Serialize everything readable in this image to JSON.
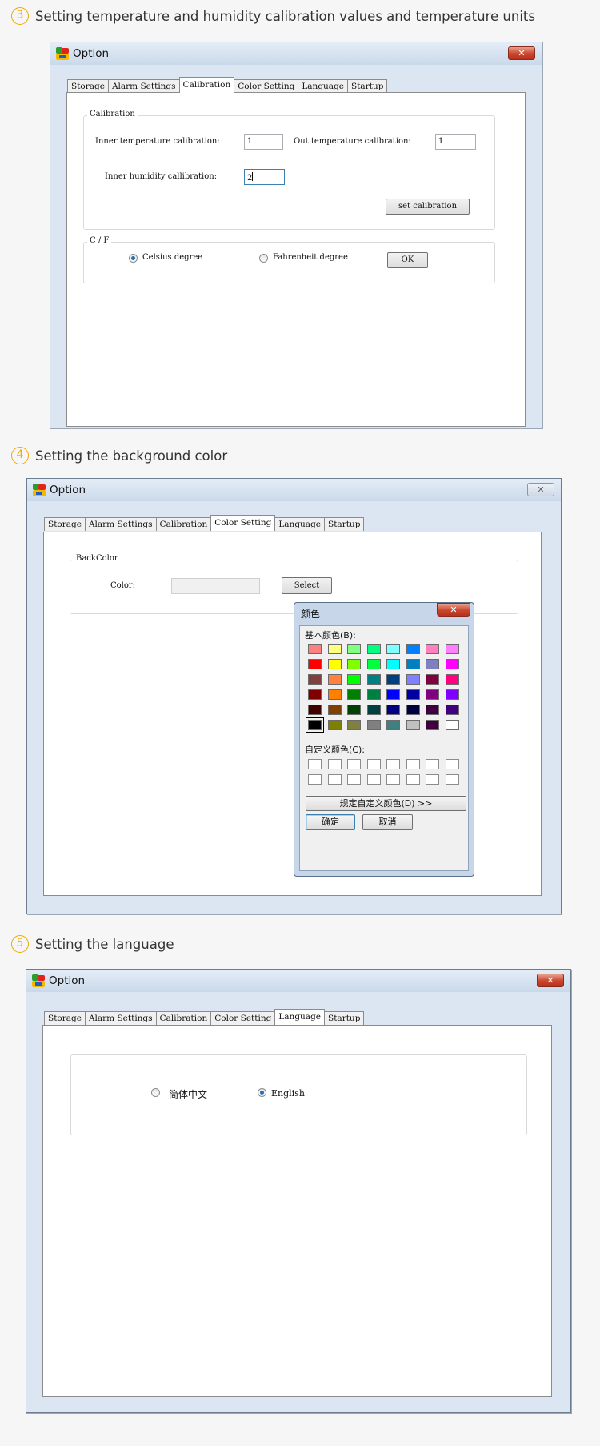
{
  "steps": [
    {
      "num": "3",
      "text": "Setting temperature and humidity calibration values and temperature units"
    },
    {
      "num": "4",
      "text": "Setting the background color"
    },
    {
      "num": "5",
      "text": "Setting the language"
    }
  ],
  "window": {
    "title": "Option",
    "close_glyph": "✕",
    "tabs": [
      "Storage",
      "Alarm Settings",
      "Calibration",
      "Color Setting",
      "Language",
      "Startup"
    ]
  },
  "calibration": {
    "group_label": "Calibration",
    "inner_temp_label": "Inner temperature calibration:",
    "inner_temp_value": "1",
    "out_temp_label": "Out temperature calibration:",
    "out_temp_value": "1",
    "inner_humidity_label": "Inner humidity callibration:",
    "inner_humidity_value": "2",
    "set_button": "set calibration",
    "unit_group_label": "C / F",
    "celsius_label": "Celsius degree",
    "fahrenheit_label": "Fahrenheit degree",
    "selected_unit": "celsius",
    "ok_button": "OK"
  },
  "color_setting": {
    "group_label": "BackColor",
    "color_label": "Color:",
    "select_button": "Select",
    "dialog": {
      "title": "颜色",
      "basic_colors_label": "基本颜色(B):",
      "custom_colors_label": "自定义颜色(C):",
      "define_button": "规定自定义颜色(D) >>",
      "ok_button": "确定",
      "cancel_button": "取消",
      "basic_colors": [
        [
          "#ff8080",
          "#ffff80",
          "#80ff80",
          "#00ff80",
          "#80ffff",
          "#0080ff",
          "#ff80c0",
          "#ff80ff"
        ],
        [
          "#ff0000",
          "#ffff00",
          "#80ff00",
          "#00ff40",
          "#00ffff",
          "#0080c0",
          "#8080c0",
          "#ff00ff"
        ],
        [
          "#804040",
          "#ff8040",
          "#00ff00",
          "#008080",
          "#004080",
          "#8080ff",
          "#800040",
          "#ff0080"
        ],
        [
          "#800000",
          "#ff8000",
          "#008000",
          "#008040",
          "#0000ff",
          "#0000a0",
          "#800080",
          "#8000ff"
        ],
        [
          "#400000",
          "#804000",
          "#004000",
          "#004040",
          "#000080",
          "#000040",
          "#400040",
          "#400080"
        ],
        [
          "#000000",
          "#808000",
          "#808040",
          "#808080",
          "#408080",
          "#c0c0c0",
          "#400040",
          "#ffffff"
        ]
      ],
      "selected_color": "#000000"
    }
  },
  "language": {
    "options": [
      "简体中文",
      "English"
    ],
    "selected": "English"
  }
}
